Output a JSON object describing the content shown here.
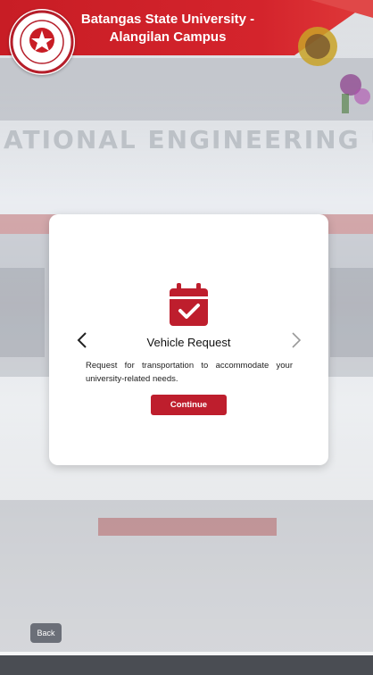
{
  "header": {
    "title": "Batangas State University - Alangilan Campus"
  },
  "background": {
    "banner_text": "ATIONAL ENGINEERING U"
  },
  "card": {
    "icon": "calendar-check-icon",
    "title": "Vehicle Request",
    "description": "Request for transportation to accommodate your university-related needs.",
    "continue_label": "Continue",
    "prev_icon": "chevron-left-icon",
    "next_icon": "chevron-right-icon"
  },
  "footer": {
    "back_label": "Back"
  },
  "colors": {
    "primary_red": "#be1e2d",
    "header_red": "#d4242c",
    "back_gray": "#6b6f78"
  }
}
